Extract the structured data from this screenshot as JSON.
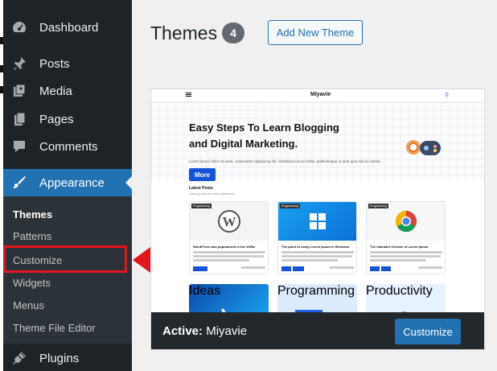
{
  "sidebar": {
    "items": [
      {
        "label": "Dashboard",
        "icon": "dashboard-icon"
      },
      {
        "label": "Posts",
        "icon": "pin-icon"
      },
      {
        "label": "Media",
        "icon": "media-icon"
      },
      {
        "label": "Pages",
        "icon": "pages-icon"
      },
      {
        "label": "Comments",
        "icon": "comment-icon"
      },
      {
        "label": "Appearance",
        "icon": "brush-icon"
      },
      {
        "label": "Plugins",
        "icon": "plugin-icon"
      }
    ],
    "submenu": [
      "Themes",
      "Patterns",
      "Customize",
      "Widgets",
      "Menus",
      "Theme File Editor"
    ]
  },
  "header": {
    "title": "Themes",
    "count": "4",
    "add_button": "Add New Theme"
  },
  "theme_card": {
    "preview": {
      "brand": "Miyavie",
      "hero_title": "Easy Steps To Learn Blogging and Digital Marketing.",
      "hero_text": "Lorem ipsum dolor sit amet, consectetur adipiscing elit. Vestibulum lacus tellus, pellentesque ut ante quis nisl ac massa.",
      "more_button": "More",
      "latest_title": "Latest Posts",
      "latest_sub": "Latest posts we have published",
      "posts": [
        {
          "tag": "Programming",
          "title": "WordPress was popularized in the 1990s"
        },
        {
          "tag": "Programming",
          "title": "The point of using Lorem Ipsum in Windows"
        },
        {
          "tag": "Programming",
          "title": "The standard Chrome of Lorem Ipsum"
        }
      ],
      "bottom_tags": [
        "Ideas",
        "Programming",
        "Productivity"
      ]
    },
    "active_label": "Active:",
    "active_name": "Miyavie",
    "customize_button": "Customize"
  },
  "colors": {
    "sidebar_bg": "#1d2327",
    "accent": "#2271b1",
    "highlight": "#e3141d"
  }
}
